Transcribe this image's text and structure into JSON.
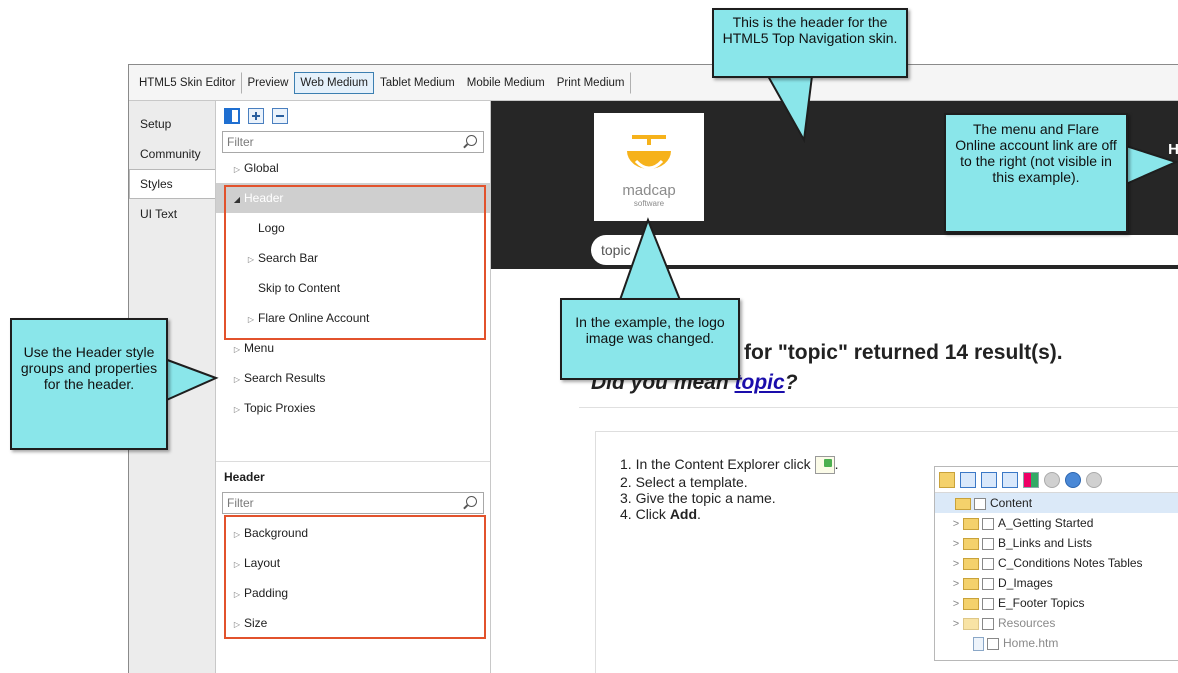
{
  "toolbar": {
    "tabs": [
      {
        "label": "HTML5 Skin Editor"
      },
      {
        "label": "Preview"
      },
      {
        "label": "Web Medium"
      },
      {
        "label": "Tablet Medium"
      },
      {
        "label": "Mobile Medium"
      },
      {
        "label": "Print Medium"
      }
    ]
  },
  "side_tabs": [
    {
      "label": "Setup"
    },
    {
      "label": "Community"
    },
    {
      "label": "Styles"
    },
    {
      "label": "UI Text"
    }
  ],
  "styles_panel": {
    "filter_placeholder": "Filter",
    "groups": {
      "global": "Global",
      "header": "Header",
      "logo": "Logo",
      "search_bar": "Search Bar",
      "skip_to_content": "Skip to Content",
      "flare_online_account": "Flare Online Account",
      "menu": "Menu",
      "search_results": "Search Results",
      "topic_proxies": "Topic Proxies"
    },
    "properties_title": "Header",
    "properties_filter_placeholder": "Filter",
    "properties": {
      "background": "Background",
      "layout": "Layout",
      "padding": "Padding",
      "size": "Size"
    }
  },
  "preview": {
    "header_bg": "#262626",
    "logo_text": "madcap",
    "logo_sub": "software",
    "search_value": "topic",
    "nav_hint": "H",
    "result_heading": "for \"topic\" returned 14 result(s).",
    "did_you_mean_prefix": "Did you mean ",
    "did_you_mean_link": "topic",
    "did_you_mean_suffix": "?",
    "steps": [
      {
        "num": "1.",
        "text": "In the Content Explorer click"
      },
      {
        "num": "2.",
        "text": "Select a template."
      },
      {
        "num": "3.",
        "text": "Give the topic a name."
      },
      {
        "num": "4.",
        "text": "Click ",
        "bold": "Add",
        "tail": "."
      }
    ],
    "explorer": {
      "root": "Content",
      "items": [
        "A_Getting Started",
        "B_Links and Lists",
        "C_Conditions Notes Tables",
        "D_Images",
        "E_Footer Topics",
        "Resources"
      ],
      "file": "Home.htm"
    }
  },
  "callouts": {
    "header_callout": "This is the header for the HTML5 Top Navigation skin.",
    "menu_callout": "The menu and Flare Online account link are off to the right (not visible in this example).",
    "logo_callout": "In the example, the logo image was changed.",
    "style_groups_callout": "Use the Header style groups and properties for the header."
  },
  "colors": {
    "callout_fill": "#8ae6ea",
    "highlight_box": "#e2522c",
    "link": "#1a0dab",
    "logo_accent": "#f6b21b"
  }
}
